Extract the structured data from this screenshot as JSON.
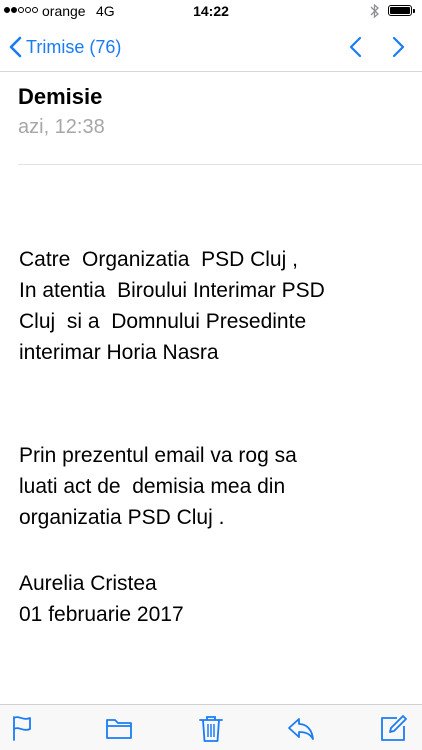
{
  "status_bar": {
    "carrier": "orange",
    "network": "4G",
    "time": "14:22"
  },
  "nav": {
    "back_label": "Trimise (76)",
    "icons": [
      "chevron-left-icon",
      "chevron-up-icon",
      "chevron-down-icon"
    ]
  },
  "message": {
    "subject": "Demisie",
    "date": "azi, 12:38",
    "body": {
      "paragraph1": [
        "Catre  Organizatia  PSD Cluj ,",
        "In atentia  Biroului Interimar PSD",
        "Cluj  si a  Domnului Presedinte",
        "interimar Horia Nasra"
      ],
      "paragraph2": [
        "Prin prezentul email va rog sa",
        "luati act de  demisia mea din",
        "organizatia PSD Cluj ."
      ],
      "signature": [
        "Aurelia Cristea",
        "01 februarie 2017"
      ]
    }
  },
  "toolbar": {
    "icons": [
      "flag-icon",
      "folder-icon",
      "trash-icon",
      "reply-icon",
      "compose-icon"
    ]
  },
  "colors": {
    "accent": "#1a7cf5",
    "date_gray": "#a6a6ab",
    "divider": "#e2e2e2"
  }
}
